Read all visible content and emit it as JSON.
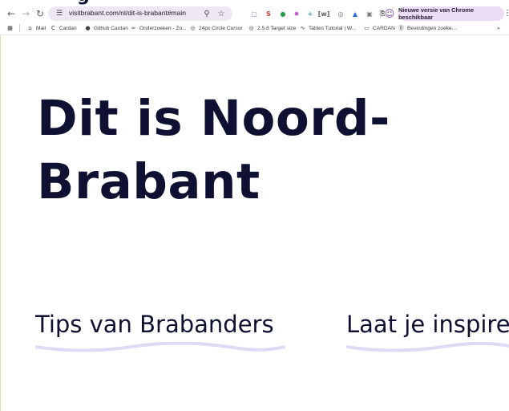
{
  "browser": {
    "url": "visitbrabant.com/nl/dit-is-brabant#main",
    "update_label": "Nieuwe versie van Chrome beschikbaar",
    "extensions": [
      {
        "name": "ext-1",
        "glyph": "▢",
        "color": "#7b7fd6"
      },
      {
        "name": "ext-2",
        "glyph": "S",
        "color": "#c0392b"
      },
      {
        "name": "ext-3",
        "glyph": "●",
        "color": "#2e9e4b"
      },
      {
        "name": "ext-4",
        "glyph": "✸",
        "color": "#c44fd0"
      },
      {
        "name": "ext-5",
        "glyph": "+",
        "color": "#3aa6a0"
      },
      {
        "name": "ext-6",
        "glyph": "[w]",
        "color": "#5a5a5a"
      },
      {
        "name": "ext-7",
        "glyph": "◎",
        "color": "#6b6b6b"
      },
      {
        "name": "ext-8",
        "glyph": "▲",
        "color": "#2b6fd6"
      },
      {
        "name": "ext-9",
        "glyph": "▣",
        "color": "#7a7a7a"
      },
      {
        "name": "ext-10",
        "glyph": "⎘",
        "color": "#3c3c3c"
      },
      {
        "name": "ext-11",
        "glyph": "☺",
        "color": "#7a3fb0"
      }
    ]
  },
  "bookmarks": {
    "items": [
      {
        "label": "Mail",
        "icon": "mail-icon",
        "glyph": "⌂"
      },
      {
        "label": "Cardan",
        "icon": "cardan-icon",
        "glyph": "C"
      },
      {
        "label": "Github Cardan",
        "icon": "github-icon",
        "glyph": "●"
      },
      {
        "label": "Onderzoeken - Zo...",
        "icon": "zoom-icon",
        "glyph": "∞"
      },
      {
        "label": "24px Circle Cursor",
        "icon": "globe-icon",
        "glyph": "◎"
      },
      {
        "label": "2.5.8 Target size",
        "icon": "globe-icon",
        "glyph": "◎"
      },
      {
        "label": "Tables Tutorial | W...",
        "icon": "tables-icon",
        "glyph": "∿"
      },
      {
        "label": "CARDAN",
        "icon": "folder-icon",
        "glyph": "▭"
      },
      {
        "label": "Bevindingen zoeke...",
        "icon": "bevindingen-icon",
        "glyph": "Ⓑ"
      }
    ],
    "overflow": "»"
  },
  "page": {
    "hero_line1": "Dit is Noord-",
    "hero_line2": "Brabant",
    "tips_heading": "Tips van Brabanders",
    "inspire_heading": "Laat je inspire"
  }
}
